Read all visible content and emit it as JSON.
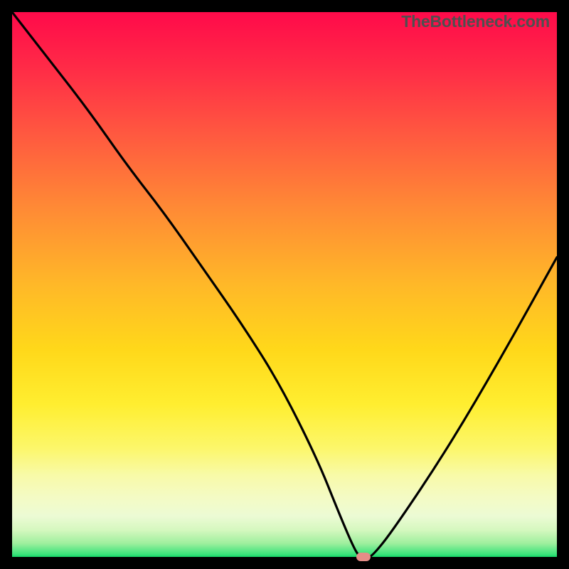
{
  "attribution": "TheBottleneck.com",
  "chart_data": {
    "type": "line",
    "title": "",
    "xlabel": "",
    "ylabel": "",
    "xlim": [
      0,
      100
    ],
    "ylim": [
      0,
      100
    ],
    "grid": false,
    "series": [
      {
        "name": "bottleneck-curve",
        "x": [
          0,
          7,
          14,
          21,
          28,
          35,
          42,
          49,
          56,
          60,
          63,
          64,
          65,
          66,
          70,
          80,
          90,
          100
        ],
        "values": [
          100,
          91,
          82,
          72,
          63,
          53,
          43,
          32,
          18,
          8,
          1,
          0,
          0,
          0,
          5,
          20,
          37,
          55
        ]
      }
    ],
    "marker": {
      "x": 64.5,
      "y": 0,
      "color": "#e58c87"
    },
    "gradient_stops": [
      {
        "pct": 0,
        "color": "#ff0a4a"
      },
      {
        "pct": 50,
        "color": "#ffd81a"
      },
      {
        "pct": 90,
        "color": "#f4fbc4"
      },
      {
        "pct": 100,
        "color": "#17d86a"
      }
    ]
  }
}
